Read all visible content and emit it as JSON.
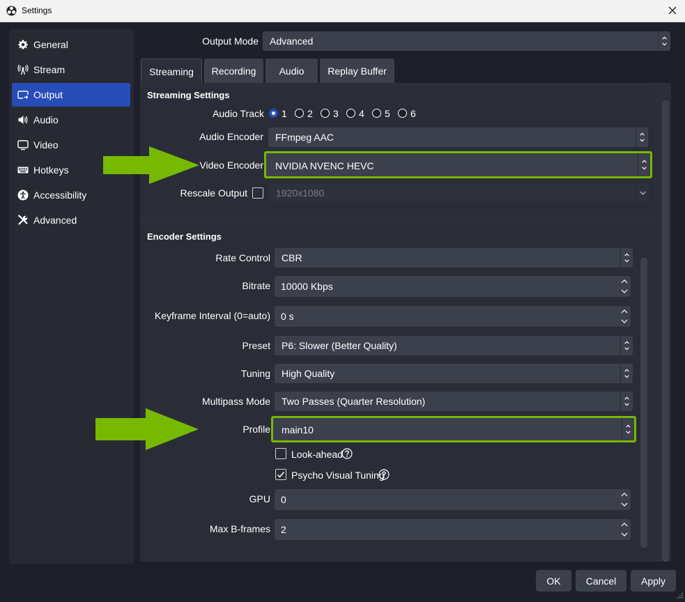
{
  "window": {
    "title": "Settings"
  },
  "sidebar": {
    "items": [
      {
        "label": "General",
        "icon": "gear-icon"
      },
      {
        "label": "Stream",
        "icon": "antenna-icon"
      },
      {
        "label": "Output",
        "icon": "output-icon"
      },
      {
        "label": "Audio",
        "icon": "speaker-icon"
      },
      {
        "label": "Video",
        "icon": "monitor-icon"
      },
      {
        "label": "Hotkeys",
        "icon": "keyboard-icon"
      },
      {
        "label": "Accessibility",
        "icon": "accessibility-icon"
      },
      {
        "label": "Advanced",
        "icon": "tools-icon"
      }
    ],
    "selected": "Output"
  },
  "output_mode": {
    "label": "Output Mode",
    "value": "Advanced"
  },
  "tabs": [
    {
      "label": "Streaming"
    },
    {
      "label": "Recording"
    },
    {
      "label": "Audio"
    },
    {
      "label": "Replay Buffer"
    }
  ],
  "active_tab": "Streaming",
  "streaming_settings": {
    "title": "Streaming Settings",
    "audio_track": {
      "label": "Audio Track",
      "options": [
        "1",
        "2",
        "3",
        "4",
        "5",
        "6"
      ],
      "selected": "1"
    },
    "audio_encoder": {
      "label": "Audio Encoder",
      "value": "FFmpeg AAC"
    },
    "video_encoder": {
      "label": "Video Encoder",
      "value": "NVIDIA NVENC HEVC"
    },
    "rescale_output": {
      "label": "Rescale Output",
      "value": "1920x1080",
      "checked": false
    }
  },
  "encoder_settings": {
    "title": "Encoder Settings",
    "rate_control": {
      "label": "Rate Control",
      "value": "CBR"
    },
    "bitrate": {
      "label": "Bitrate",
      "value": "10000 Kbps"
    },
    "keyframe_interval": {
      "label": "Keyframe Interval (0=auto)",
      "value": "0 s"
    },
    "preset": {
      "label": "Preset",
      "value": "P6: Slower (Better Quality)"
    },
    "tuning": {
      "label": "Tuning",
      "value": "High Quality"
    },
    "multipass_mode": {
      "label": "Multipass Mode",
      "value": "Two Passes (Quarter Resolution)"
    },
    "profile": {
      "label": "Profile",
      "value": "main10"
    },
    "look_ahead": {
      "label": "Look-ahead",
      "checked": false
    },
    "psycho_visual_tuning": {
      "label": "Psycho Visual Tuning",
      "checked": true
    },
    "gpu": {
      "label": "GPU",
      "value": "0"
    },
    "max_b_frames": {
      "label": "Max B-frames",
      "value": "2"
    }
  },
  "buttons": {
    "ok": "OK",
    "cancel": "Cancel",
    "apply": "Apply"
  },
  "colors": {
    "accent": "#284cb8",
    "highlight": "#76b900",
    "background": "#1e2029",
    "panel": "#2c2f39",
    "input": "#3c404d"
  }
}
